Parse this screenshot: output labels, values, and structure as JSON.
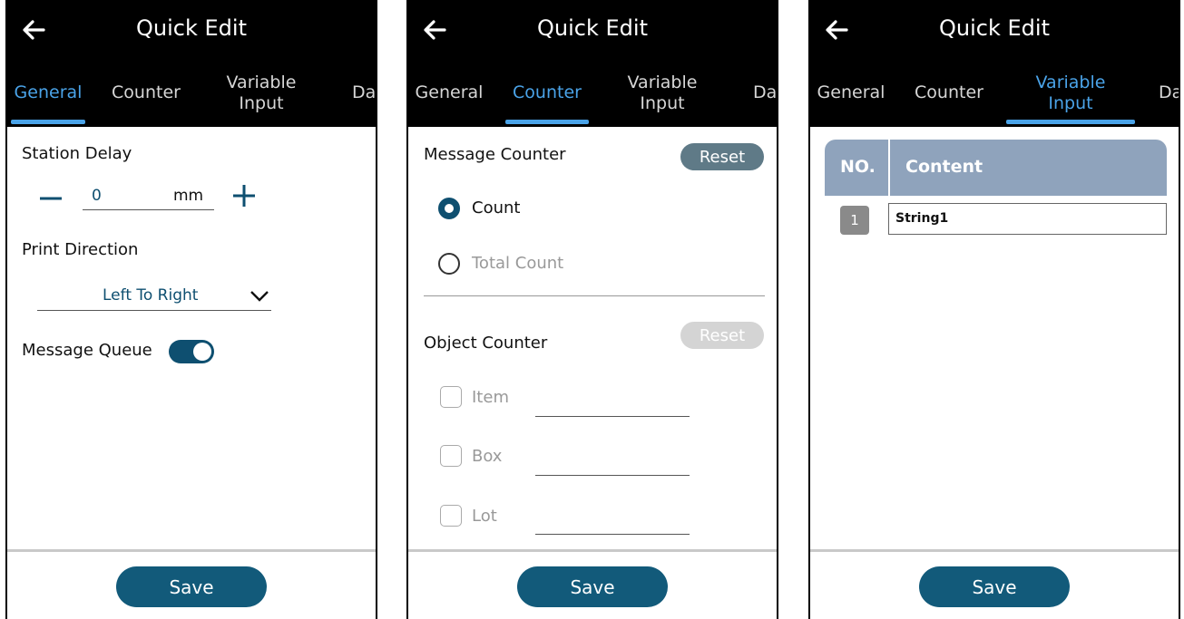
{
  "screens": [
    {
      "title": "Quick Edit",
      "tabs": [
        "General",
        "Counter",
        "Variable\nInput",
        "Da"
      ],
      "active_tab": 0,
      "general": {
        "station_delay_label": "Station Delay",
        "station_delay_value": "0",
        "station_delay_unit": "mm",
        "print_direction_label": "Print Direction",
        "print_direction_value": "Left To Right",
        "message_queue_label": "Message Queue",
        "message_queue_on": true
      },
      "save_label": "Save"
    },
    {
      "title": "Quick Edit",
      "tabs": [
        "General",
        "Counter",
        "Variable\nInput",
        "Da"
      ],
      "active_tab": 1,
      "counter": {
        "message_counter_label": "Message Counter",
        "reset_label": "Reset",
        "count_label": "Count",
        "total_count_label": "Total Count",
        "object_counter_label": "Object Counter",
        "object_reset_label": "Reset",
        "item_label": "Item",
        "box_label": "Box",
        "lot_label": "Lot"
      },
      "save_label": "Save"
    },
    {
      "title": "Quick Edit",
      "tabs": [
        "General",
        "Counter",
        "Variable\nInput",
        "Da"
      ],
      "active_tab": 2,
      "variable_input": {
        "col_no": "NO.",
        "col_content": "Content",
        "rows": [
          {
            "no": "1",
            "content": "String1"
          }
        ]
      },
      "save_label": "Save"
    }
  ],
  "colors": {
    "accent": "#4aa3e8",
    "primary": "#125a7a",
    "reset_active": "#5f7a87",
    "reset_disabled": "#d4d4d4"
  }
}
